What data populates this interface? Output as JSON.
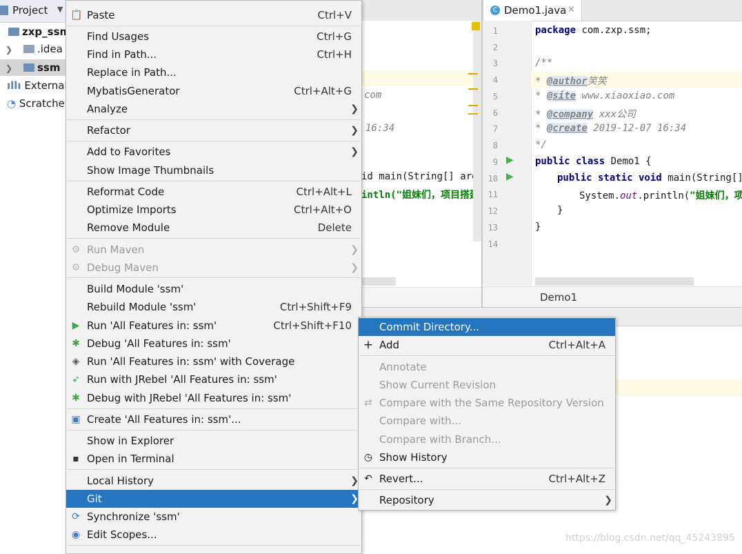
{
  "project_panel": {
    "header_label": "Project",
    "items": [
      {
        "label": "zxp_ssm"
      },
      {
        "label": ".idea"
      },
      {
        "label": "ssm"
      },
      {
        "label": "External"
      },
      {
        "label": "Scratche"
      }
    ]
  },
  "editor": {
    "tab_label": "Demo1.java",
    "left_fragments": [
      "com",
      "16:34",
      "id main(String[] args",
      "intln(\"姐妹们，项目搭建"
    ],
    "line_numbers": [
      "1",
      "2",
      "3",
      "4",
      "5",
      "6",
      "7",
      "8",
      "9",
      "10",
      "11",
      "12",
      "13",
      "14"
    ],
    "code": {
      "l1_kw": "package",
      "l1_rest": " com.zxp.ssm;",
      "l3": "/**",
      "l4_tag": "@author",
      "l4_rest": "笑笑",
      "l5_tag": "@site",
      "l5_rest": " www.xiaoxiao.com",
      "l6_tag": "@company",
      "l6_rest": " xxx公司",
      "l7_tag": "@create",
      "l7_rest": " 2019-12-07 16:34",
      "l8": " */",
      "l9_kw": "public class",
      "l9_rest": " Demo1 {",
      "l10_kw": "public static void",
      "l10_rest": " main(String[] args",
      "l11_a": "System.",
      "l11_field": "out",
      "l11_b": ".println(",
      "l11_str": "\"姐妹们，项",
      "l12": "}",
      "l13": "}"
    },
    "breadcrumb": "Demo1"
  },
  "context_menu": {
    "top_partial": "Paste",
    "top_partial_shortcut": "Ctrl+V",
    "items": [
      {
        "label": "Find Usages",
        "shortcut": "Ctrl+G"
      },
      {
        "label": "Find in Path...",
        "shortcut": "Ctrl+H"
      },
      {
        "label": "Replace in Path...",
        "shortcut": ""
      },
      {
        "label": "MybatisGenerator",
        "shortcut": "Ctrl+Alt+G"
      },
      {
        "label": "Analyze",
        "shortcut": ""
      },
      {
        "label": "Refactor",
        "shortcut": ""
      },
      {
        "label": "Add to Favorites",
        "shortcut": ""
      },
      {
        "label": "Show Image Thumbnails",
        "shortcut": ""
      },
      {
        "label": "Reformat Code",
        "shortcut": "Ctrl+Alt+L"
      },
      {
        "label": "Optimize Imports",
        "shortcut": "Ctrl+Alt+O"
      },
      {
        "label": "Remove Module",
        "shortcut": "Delete"
      },
      {
        "label": "Run Maven",
        "shortcut": ""
      },
      {
        "label": "Debug Maven",
        "shortcut": ""
      },
      {
        "label": "Build Module 'ssm'",
        "shortcut": ""
      },
      {
        "label": "Rebuild Module 'ssm'",
        "shortcut": "Ctrl+Shift+F9"
      },
      {
        "label": "Run 'All Features in: ssm'",
        "shortcut": "Ctrl+Shift+F10"
      },
      {
        "label": "Debug 'All Features in: ssm'",
        "shortcut": ""
      },
      {
        "label": "Run 'All Features in: ssm' with Coverage",
        "shortcut": ""
      },
      {
        "label": "Run with JRebel 'All Features in: ssm'",
        "shortcut": ""
      },
      {
        "label": "Debug with JRebel 'All Features in: ssm'",
        "shortcut": ""
      },
      {
        "label": "Create 'All Features in: ssm'...",
        "shortcut": ""
      },
      {
        "label": "Show in Explorer",
        "shortcut": ""
      },
      {
        "label": "Open in Terminal",
        "shortcut": ""
      },
      {
        "label": "Local History",
        "shortcut": ""
      },
      {
        "label": "Git",
        "shortcut": ""
      },
      {
        "label": "Synchronize 'ssm'",
        "shortcut": ""
      },
      {
        "label": "Edit Scopes...",
        "shortcut": ""
      }
    ]
  },
  "git_submenu": {
    "items": [
      {
        "label": "Commit Directory...",
        "shortcut": ""
      },
      {
        "label": "Add",
        "shortcut": "Ctrl+Alt+A"
      },
      {
        "label": "Annotate",
        "shortcut": ""
      },
      {
        "label": "Show Current Revision",
        "shortcut": ""
      },
      {
        "label": "Compare with the Same Repository Version",
        "shortcut": ""
      },
      {
        "label": "Compare with...",
        "shortcut": ""
      },
      {
        "label": "Compare with Branch...",
        "shortcut": ""
      },
      {
        "label": "Show History",
        "shortcut": ""
      },
      {
        "label": "Revert...",
        "shortcut": "Ctrl+Alt+Z"
      },
      {
        "label": "Repository",
        "shortcut": ""
      }
    ]
  },
  "watermark": "https://blog.csdn.net/qq_45243895",
  "colors": {
    "highlight": "#2675bf",
    "menu_bg": "#f2f2f2",
    "disabled_text": "#9a9a9a"
  }
}
